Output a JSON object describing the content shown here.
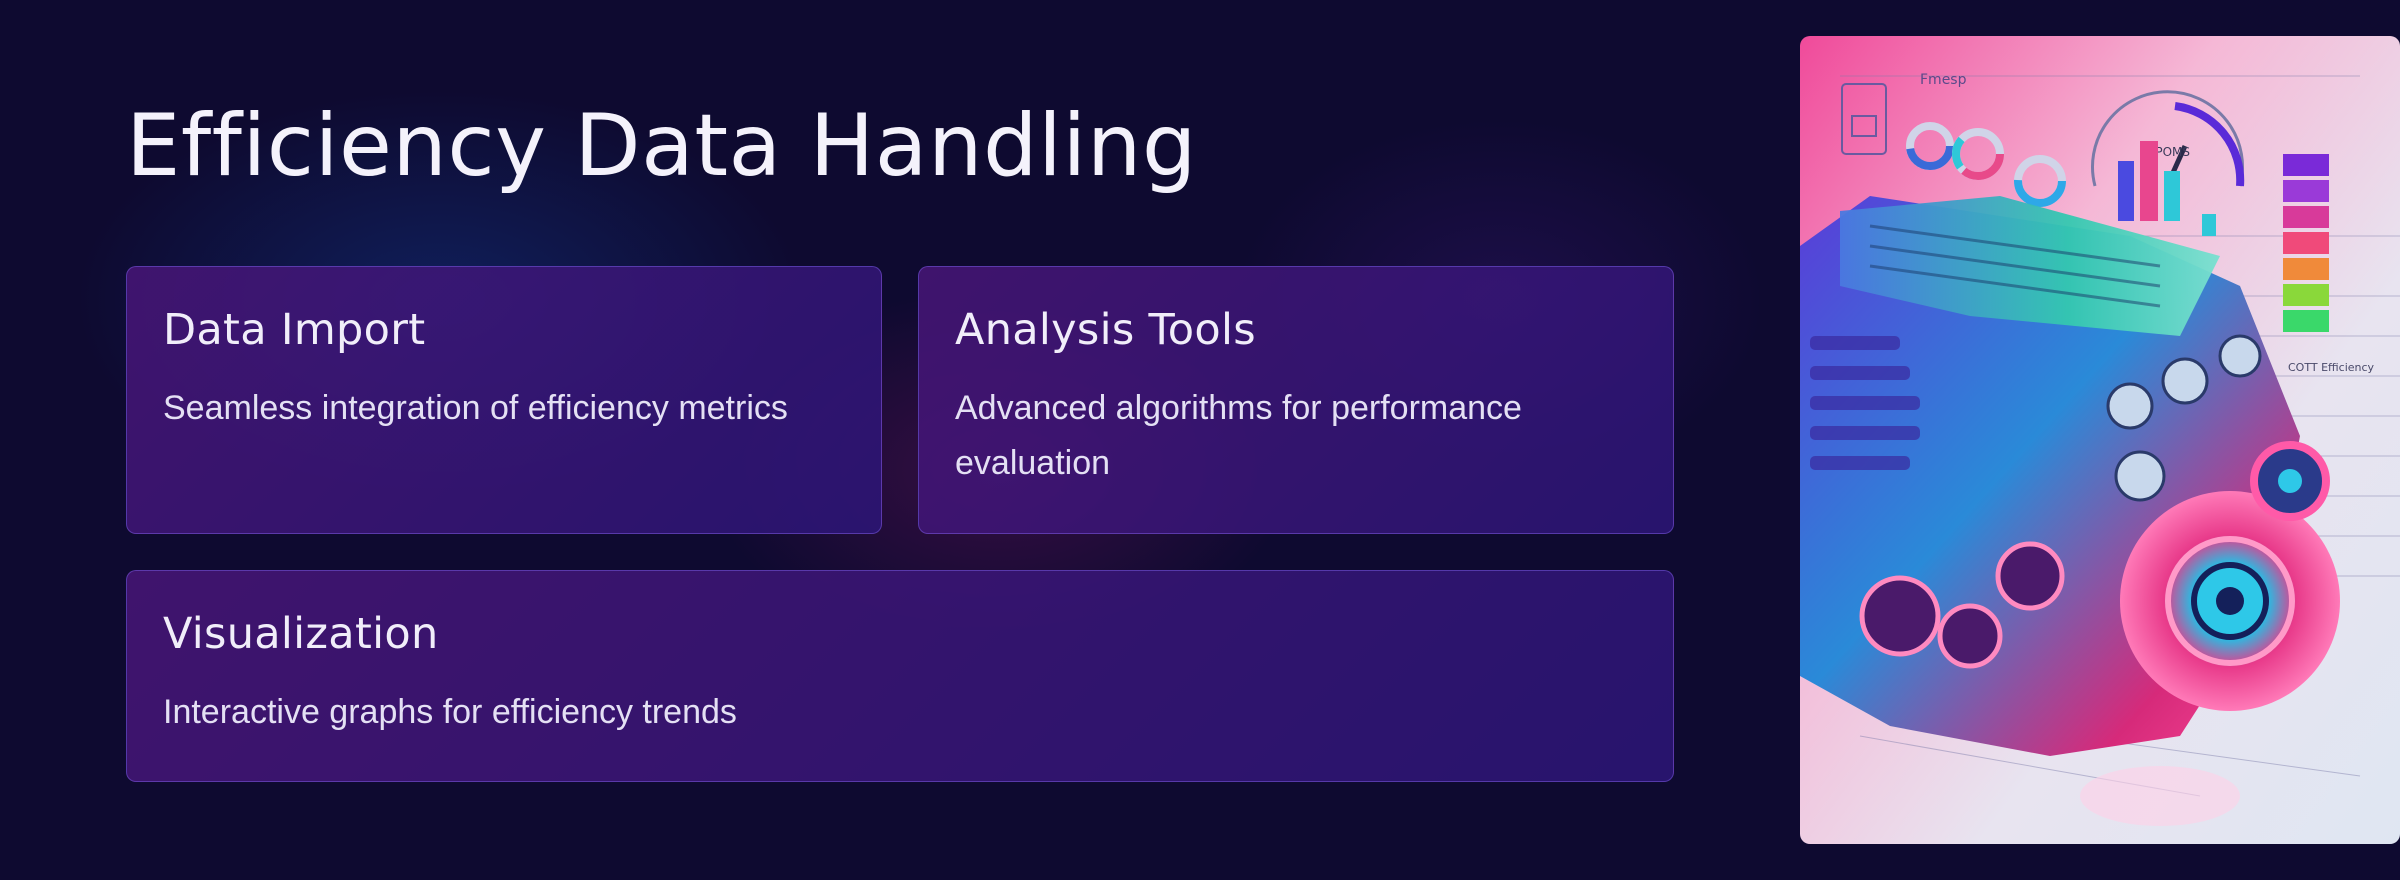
{
  "slide": {
    "title": "Efficiency Data Handling"
  },
  "cards": [
    {
      "title": "Data Import",
      "description": "Seamless integration of efficiency metrics"
    },
    {
      "title": "Analysis Tools",
      "description": "Advanced algorithms for performance evaluation"
    },
    {
      "title": "Visualization",
      "description": "Interactive graphs for efficiency trends"
    }
  ],
  "image": {
    "subject": "engine-with-efficiency-dashboard-illustration",
    "label_top": "Fmesp",
    "label_gauge": "RPOMS",
    "label_side": "COTT Efficiency"
  },
  "colors": {
    "background": "#0e0a30",
    "card_fill": "#3a1878",
    "card_border": "#6a4fc8",
    "accent_pink": "#ff3c8c",
    "accent_teal": "#2ec8d8",
    "accent_violet": "#7a3cf0"
  }
}
